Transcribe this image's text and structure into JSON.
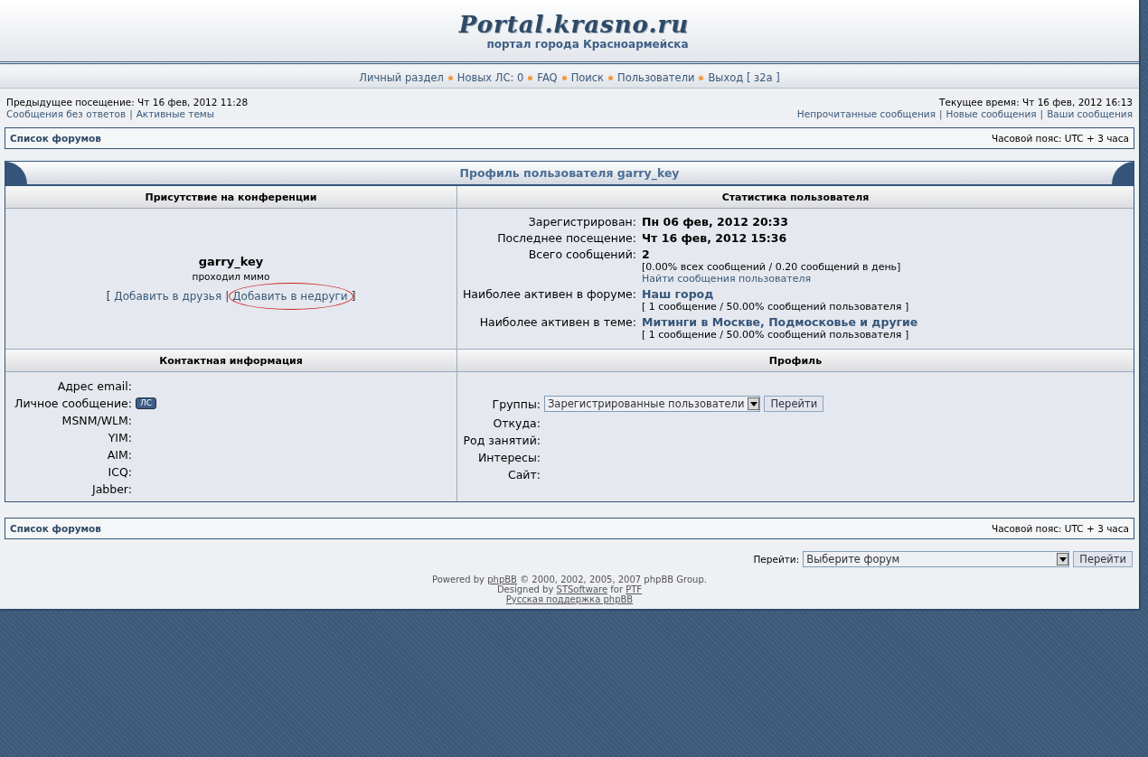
{
  "header": {
    "logo": "Portal.krasno.ru",
    "subtitle": "портал города Красноармейска"
  },
  "nav": [
    "Личный раздел",
    "Новых ЛС: 0",
    "FAQ",
    "Поиск",
    "Пользователи",
    "Выход [ з2а ]"
  ],
  "info": {
    "previous_visit": "Предыдущее посещение: Чт 16 фев, 2012 11:28",
    "current_time": "Текущее время: Чт 16 фев, 2012 16:13",
    "left_links": [
      "Сообщения без ответов",
      "Активные темы"
    ],
    "right_links": [
      "Непрочитанные сообщения",
      "Новые сообщения",
      "Ваши сообщения"
    ],
    "separator": "|"
  },
  "forum_bar_top": {
    "link": "Список форумов",
    "timezone": "Часовой пояс: UTC + 3 часа"
  },
  "profile": {
    "title": "Профиль пользователя garry_key",
    "presence_header": "Присутствие на конференции",
    "stats_header": "Статистика пользователя",
    "username": "garry_key",
    "rank": "проходил мимо",
    "actions_open": "[",
    "actions_close": "]",
    "actions_separator": "|",
    "actions": [
      {
        "label": "Добавить в друзья",
        "highlighted": false
      },
      {
        "label": "Добавить в недруги",
        "highlighted": true
      }
    ],
    "stats": [
      {
        "label": "Зарегистрирован:",
        "value": "Пн 06 фев, 2012 20:33",
        "kind": "bold"
      },
      {
        "label": "Последнее посещение:",
        "value": "Чт 16 фев, 2012 15:36",
        "kind": "bold"
      },
      {
        "label": "Всего сообщений:",
        "value": "2",
        "kind": "bold",
        "notes": [
          "[0.00% всех сообщений / 0.20 сообщений в день]"
        ],
        "link": "Найти сообщения пользователя"
      },
      {
        "label": "Наиболее активен в форуме:",
        "value": "Наш город",
        "kind": "link",
        "notes": [
          "[ 1 сообщение / 50.00% сообщений пользователя ]"
        ]
      },
      {
        "label": "Наиболее активен в теме:",
        "value": "Митинги в Москве, Подмосковье и другие",
        "kind": "link",
        "notes": [
          "[ 1 сообщение / 50.00% сообщений пользователя ]"
        ]
      }
    ],
    "contact_header": "Контактная информация",
    "profile_header": "Профиль",
    "contacts": [
      {
        "label": "Адрес email:"
      },
      {
        "label": "Личное сообщение:",
        "button": "ЛС"
      },
      {
        "label": "MSNM/WLM:"
      },
      {
        "label": "YIM:"
      },
      {
        "label": "AIM:"
      },
      {
        "label": "ICQ:"
      },
      {
        "label": "Jabber:"
      }
    ],
    "profile_fields": [
      {
        "label": "Группы:",
        "kind": "select",
        "value": "Зарегистрированные пользователи",
        "button": "Перейти"
      },
      {
        "label": "Откуда:",
        "kind": "text"
      },
      {
        "label": "Род занятий:",
        "kind": "text"
      },
      {
        "label": "Интересы:",
        "kind": "text"
      },
      {
        "label": "Сайт:",
        "kind": "text"
      }
    ]
  },
  "forum_bar_bottom": {
    "link": "Список форумов",
    "timezone": "Часовой пояс: UTC + 3 часа"
  },
  "jump": {
    "label": "Перейти:",
    "value": "Выберите форум",
    "button": "Перейти"
  },
  "footer": [
    [
      {
        "text": "Powered by "
      },
      {
        "text": "phpBB",
        "link": true
      },
      {
        "text": " © 2000, 2002, 2005, 2007 phpBB Group."
      }
    ],
    [
      {
        "text": "Designed by "
      },
      {
        "text": "STSoftware",
        "link": true
      },
      {
        "text": " for "
      },
      {
        "text": "PTF",
        "link": true
      }
    ],
    [
      {
        "text": "Русская поддержка phpBB",
        "link": true
      }
    ]
  ]
}
